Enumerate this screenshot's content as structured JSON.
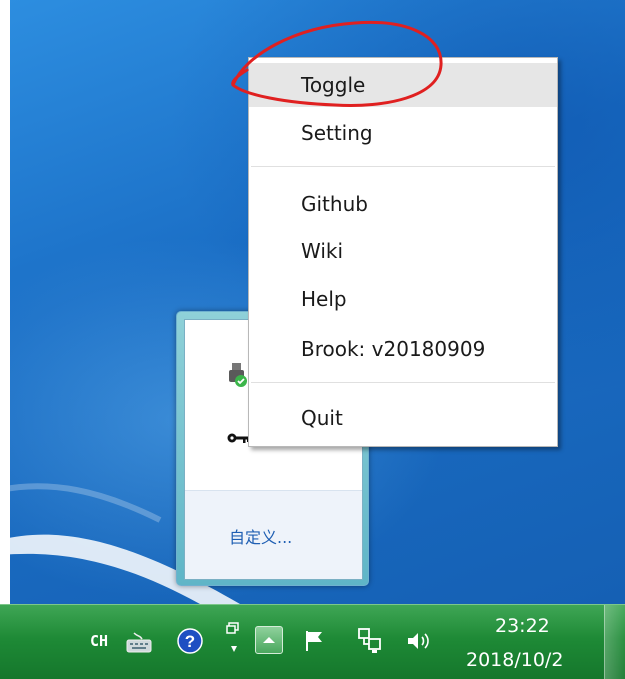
{
  "context_menu": {
    "items": [
      {
        "label": "Toggle"
      },
      {
        "label": "Setting"
      },
      {
        "label": "Github"
      },
      {
        "label": "Wiki"
      },
      {
        "label": "Help"
      },
      {
        "label": "Brook: v20180909"
      },
      {
        "label": "Quit"
      }
    ]
  },
  "tray_overflow": {
    "customize_label": "自定义..."
  },
  "taskbar": {
    "language": "CH",
    "time": "23:22",
    "date": "2018/10/2",
    "icons": [
      "keyboard-icon",
      "help-icon",
      "pen-icon",
      "show-hidden-icons-button",
      "flag-icon",
      "network-icon",
      "volume-icon"
    ]
  },
  "colors": {
    "annotation": "#e02020",
    "taskbar": "#1e8a36",
    "desktop": "#1b6fc6",
    "menu_highlight": "#e6e6e6"
  }
}
